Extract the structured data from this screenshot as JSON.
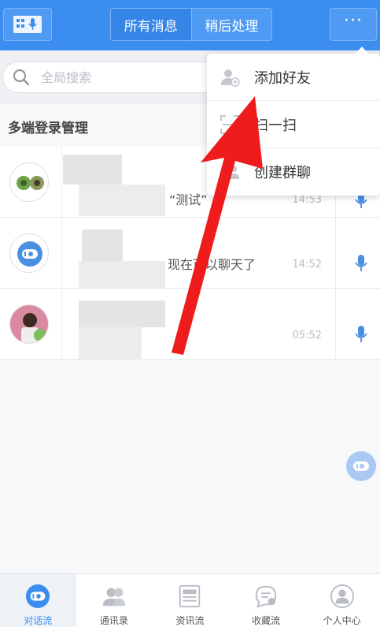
{
  "header": {
    "tabs": [
      {
        "label": "所有消息",
        "active": true
      },
      {
        "label": "稍后处理",
        "active": false
      }
    ],
    "more_label": "···"
  },
  "search": {
    "placeholder": "全局搜索"
  },
  "section": {
    "title": "多端登录管理"
  },
  "conversations": [
    {
      "message": "“测试”",
      "time": "14:53"
    },
    {
      "message": "现在可以聊天了",
      "time": "14:52"
    },
    {
      "message": "",
      "time": "05:52"
    }
  ],
  "menu": {
    "items": [
      {
        "label": "添加好友",
        "icon": "add-friend-icon"
      },
      {
        "label": "扫一扫",
        "icon": "scan-icon"
      },
      {
        "label": "创建群聊",
        "icon": "group-chat-icon"
      }
    ]
  },
  "nav": {
    "items": [
      {
        "label": "对话流",
        "icon": "chat-icon",
        "active": true
      },
      {
        "label": "通讯录",
        "icon": "contacts-icon",
        "active": false
      },
      {
        "label": "资讯流",
        "icon": "news-icon",
        "active": false
      },
      {
        "label": "收藏流",
        "icon": "favorites-icon",
        "active": false
      },
      {
        "label": "个人中心",
        "icon": "profile-icon",
        "active": false
      }
    ]
  },
  "colors": {
    "primary": "#3b8ef0",
    "arrow": "#ee1c1c"
  }
}
